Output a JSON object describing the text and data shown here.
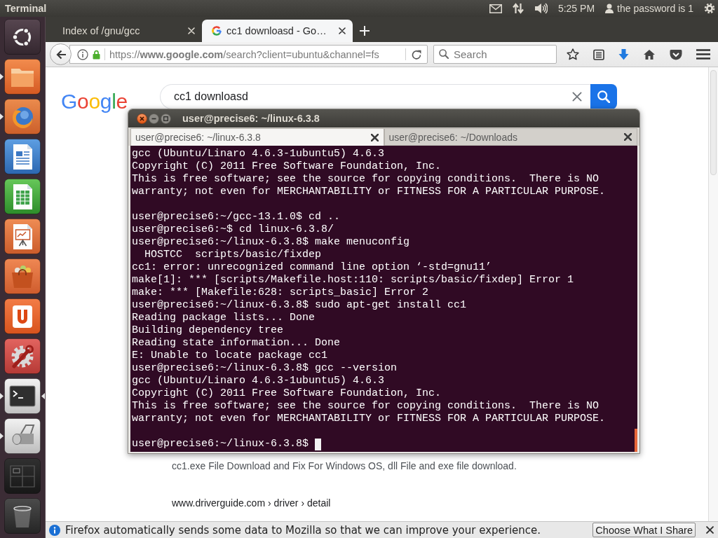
{
  "top_panel": {
    "app_name": "Terminal",
    "clock": "5:25 PM",
    "user_name": "the password is 1"
  },
  "launcher": {
    "items": [
      {
        "kind": "dash",
        "running": false,
        "focused": false
      },
      {
        "kind": "files",
        "running": true,
        "focused": false
      },
      {
        "kind": "browser",
        "running": true,
        "focused": false
      },
      {
        "kind": "writer",
        "running": false,
        "focused": false
      },
      {
        "kind": "calc",
        "running": false,
        "focused": false
      },
      {
        "kind": "impress",
        "running": false,
        "focused": false
      },
      {
        "kind": "software",
        "running": false,
        "focused": false
      },
      {
        "kind": "cloud",
        "running": false,
        "focused": false
      },
      {
        "kind": "settings",
        "running": false,
        "focused": false
      },
      {
        "kind": "terminal",
        "running": true,
        "focused": true
      },
      {
        "kind": "scanner",
        "running": true,
        "focused": false
      },
      {
        "kind": "workspaces",
        "running": false,
        "focused": false
      },
      {
        "kind": "trash",
        "running": false,
        "focused": false
      }
    ]
  },
  "browser": {
    "tabs": [
      {
        "title": "Index of /gnu/gcc",
        "selected": false,
        "favicon": false
      },
      {
        "title": "cc1 downloasd - Go…",
        "selected": true,
        "favicon": true
      }
    ],
    "url": "https://**www.google.com**/search?client=ubuntu&channel=fs",
    "search_placeholder": "Search",
    "page": {
      "logo": "Google",
      "query": "cc1 downloasd",
      "results": [
        {
          "kind": "snippet",
          "text": "cc1.exe File Download and Fix For Windows OS, dll File and exe file download."
        },
        {
          "kind": "url",
          "text": "www.driverguide.com › driver › detail"
        }
      ]
    },
    "notification": {
      "message": "Firefox automatically sends some data to Mozilla so that we can improve your experience.",
      "button": "Choose What I Share"
    }
  },
  "terminal": {
    "title": "user@precise6: ~/linux-6.3.8",
    "tabs": [
      {
        "title": "user@precise6: ~/linux-6.3.8",
        "selected": true
      },
      {
        "title": "user@precise6: ~/Downloads",
        "selected": false
      }
    ],
    "blocks": [
      [
        "gcc (Ubuntu/Linaro 4.6.3-1ubuntu5) 4.6.3",
        "Copyright (C) 2011 Free Software Foundation, Inc.",
        "This is free software; see the source for copying conditions.  There is NO",
        "warranty; not even for MERCHANTABILITY or FITNESS FOR A PARTICULAR PURPOSE."
      ],
      [
        "user@precise6:~/gcc-13.1.0$ cd ..",
        "user@precise6:~$ cd linux-6.3.8/",
        "user@precise6:~/linux-6.3.8$ make menuconfig",
        "  HOSTCC  scripts/basic/fixdep",
        "cc1: error: unrecognized command line option ‘-std=gnu11’",
        "make[1]: *** [scripts/Makefile.host:110: scripts/basic/fixdep] Error 1",
        "make: *** [Makefile:628: scripts_basic] Error 2",
        "user@precise6:~/linux-6.3.8$ sudo apt-get install cc1",
        "Reading package lists... Done",
        "Building dependency tree",
        "Reading state information... Done",
        "E: Unable to locate package cc1",
        "user@precise6:~/linux-6.3.8$ gcc --version",
        "gcc (Ubuntu/Linaro 4.6.3-1ubuntu5) 4.6.3",
        "Copyright (C) 2011 Free Software Foundation, Inc.",
        "This is free software; see the source for copying conditions.  There is NO",
        "warranty; not even for MERCHANTABILITY or FITNESS FOR A PARTICULAR PURPOSE."
      ]
    ],
    "prompt": "user@precise6:~/linux-6.3.8$"
  }
}
